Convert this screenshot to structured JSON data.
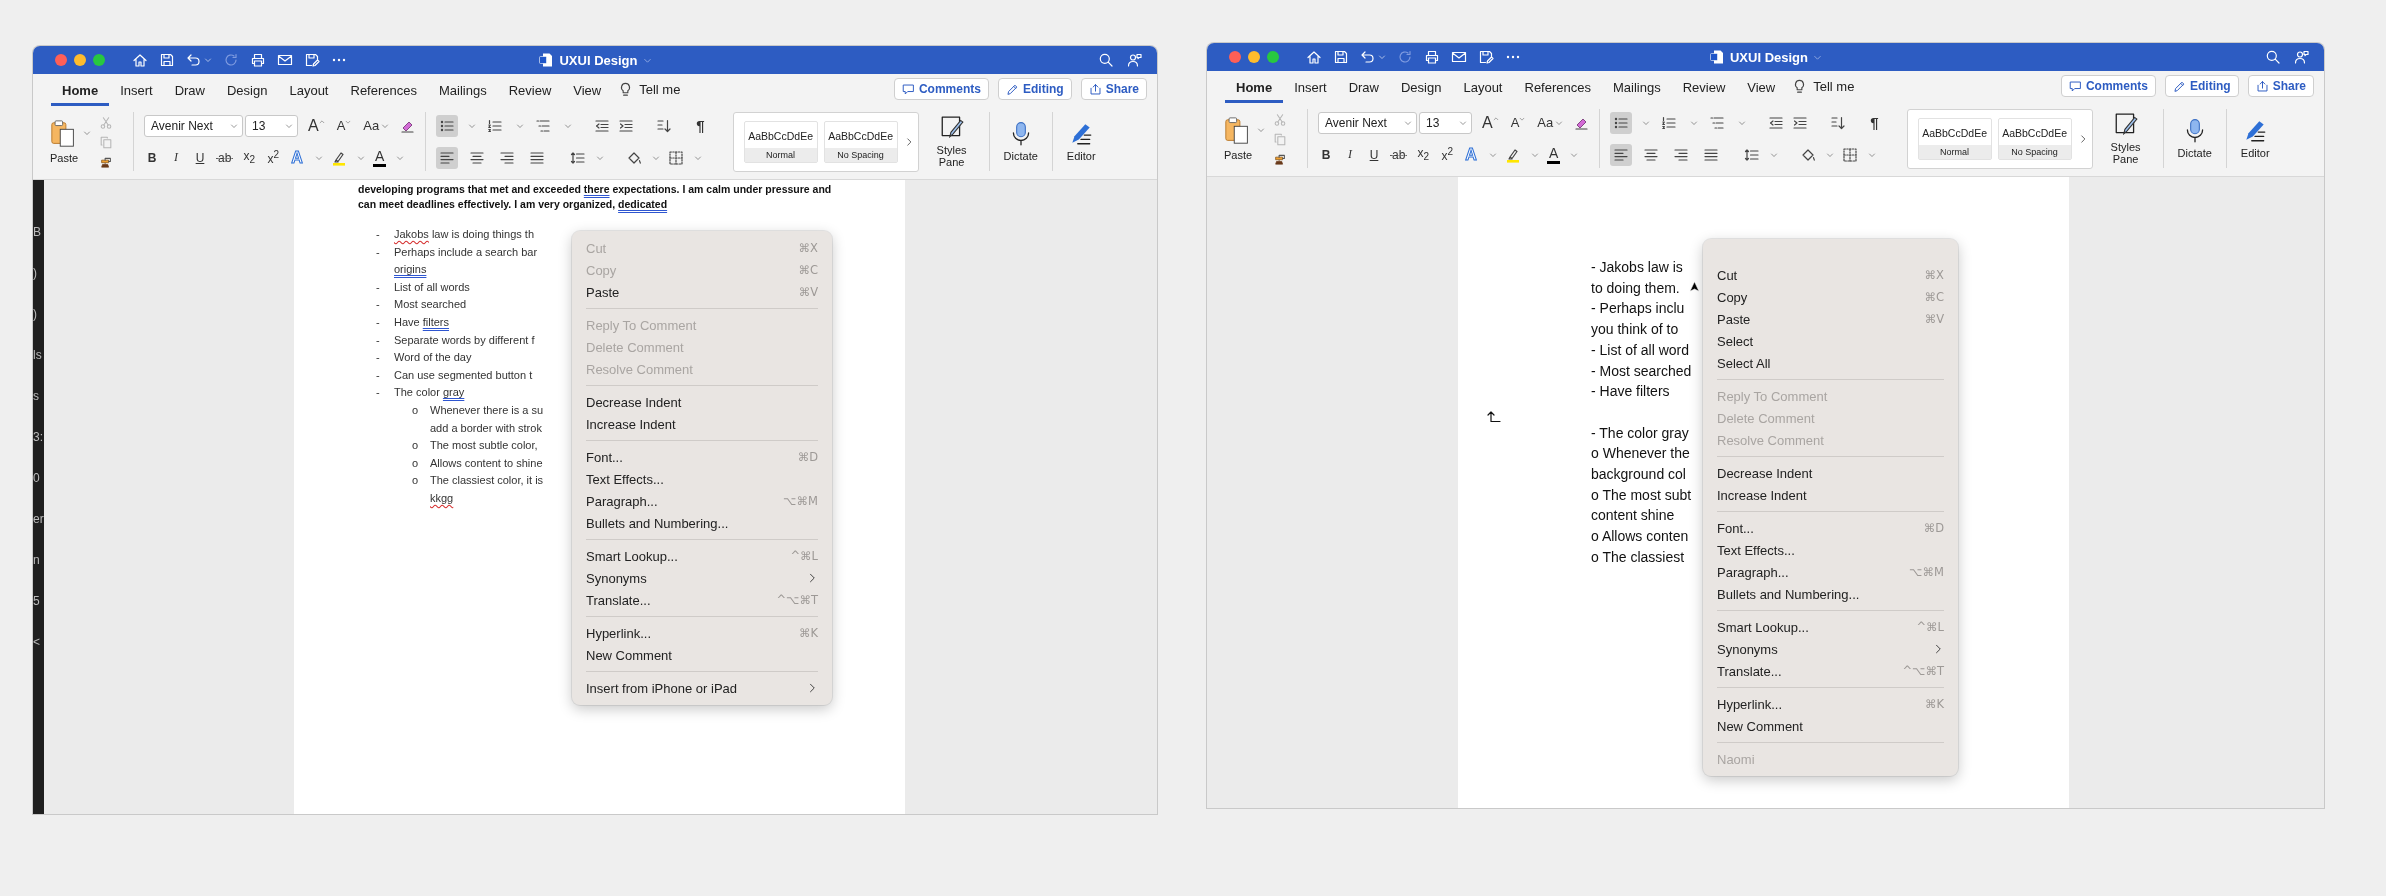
{
  "windows": [
    {
      "title": "UXUI Design",
      "quick_access": [
        {
          "kind": "home",
          "disabled": false
        },
        {
          "kind": "save",
          "disabled": false
        },
        {
          "kind": "undo",
          "disabled": false
        },
        {
          "kind": "redo",
          "disabled": true
        },
        {
          "kind": "print",
          "disabled": false
        },
        {
          "kind": "mail",
          "disabled": false
        },
        {
          "kind": "saveas",
          "disabled": false
        },
        {
          "kind": "more",
          "disabled": false
        }
      ],
      "tabs": [
        {
          "label": "Home",
          "selected": true
        },
        {
          "label": "Insert",
          "selected": false
        },
        {
          "label": "Draw",
          "selected": false
        },
        {
          "label": "Design",
          "selected": false
        },
        {
          "label": "Layout",
          "selected": false
        },
        {
          "label": "References",
          "selected": false
        },
        {
          "label": "Mailings",
          "selected": false
        },
        {
          "label": "Review",
          "selected": false
        },
        {
          "label": "View",
          "selected": false
        }
      ],
      "tell_me": "Tell me",
      "actions": [
        {
          "kind": "comments",
          "label": "Comments"
        },
        {
          "kind": "editing",
          "label": "Editing"
        },
        {
          "kind": "share",
          "label": "Share"
        }
      ],
      "ribbon": {
        "paste": "Paste",
        "clipboard_tools": [
          {
            "kind": "cut",
            "disabled": true
          },
          {
            "kind": "copy",
            "disabled": true
          },
          {
            "kind": "painter",
            "disabled": false
          }
        ],
        "font_name": "Avenir Next",
        "font_size": "13",
        "grow_font": "A",
        "shrink_font": "A",
        "change_case": "Aa",
        "format_buttons": [
          "B",
          "I",
          "U",
          "ab",
          "x$_{2}$",
          "x$^{2}$"
        ],
        "text_effects": "A",
        "font_color": "A",
        "list_buttons": [
          {
            "kind": "bullets",
            "selected": true
          },
          {
            "kind": "numbering",
            "selected": false
          },
          {
            "kind": "multilevel",
            "selected": false
          }
        ],
        "show_marks": "¶",
        "align_buttons": [
          {
            "kind": "left",
            "selected": true
          },
          {
            "kind": "center",
            "selected": false
          },
          {
            "kind": "right",
            "selected": false
          },
          {
            "kind": "justify",
            "selected": false
          }
        ],
        "styles": [
          {
            "sample": "AaBbCcDdEe",
            "name": "Normal"
          },
          {
            "sample": "AaBbCcDdEe",
            "name": "No Spacing"
          }
        ],
        "styles_pane": "Styles Pane",
        "dictate": "Dictate",
        "editor": "Editor"
      },
      "side_strip": {
        "fragments": [
          "B",
          ")",
          ")",
          "ls",
          "s",
          "3:",
          "0",
          "er",
          "n",
          "5",
          "<"
        ]
      },
      "document": {
        "kind": "outline",
        "intro": [
          [
            {
              "kind": "plain",
              "text": "developing programs that met and exceeded "
            },
            {
              "kind": "grammar",
              "text": "there"
            },
            {
              "kind": "plain",
              "text": " expectations. I am calm under pressure and"
            }
          ],
          [
            {
              "kind": "plain",
              "text": "can meet deadlines effectively. I am very organized, "
            },
            {
              "kind": "grammar",
              "text": "dedicated"
            }
          ]
        ],
        "items": [
          {
            "marker": "-",
            "lines": [
              [
                {
                  "kind": "spelling",
                  "text": "Jakobs"
                },
                {
                  "kind": "plain",
                  "text": " law is doing things th"
                }
              ]
            ]
          },
          {
            "marker": "-",
            "lines": [
              [
                {
                  "kind": "plain",
                  "text": "Perhaps include a search bar"
                }
              ],
              [
                {
                  "kind": "grammar",
                  "text": "origins"
                }
              ]
            ]
          },
          {
            "marker": "-",
            "lines": [
              [
                {
                  "kind": "plain",
                  "text": "List of all words"
                }
              ]
            ]
          },
          {
            "marker": "-",
            "lines": [
              [
                {
                  "kind": "plain",
                  "text": "Most searched"
                }
              ]
            ]
          },
          {
            "marker": "-",
            "lines": [
              [
                {
                  "kind": "plain",
                  "text": "Have "
                },
                {
                  "kind": "grammar",
                  "text": "filters"
                }
              ]
            ]
          },
          {
            "marker": "-",
            "lines": [
              [
                {
                  "kind": "plain",
                  "text": "Separate words by different f"
                }
              ]
            ]
          },
          {
            "marker": "-",
            "lines": [
              [
                {
                  "kind": "plain",
                  "text": "Word of the day"
                }
              ]
            ]
          },
          {
            "marker": "-",
            "lines": [
              [
                {
                  "kind": "plain",
                  "text": "Can use segmented button t"
                }
              ]
            ]
          },
          {
            "marker": "-",
            "lines": [
              [
                {
                  "kind": "plain",
                  "text": "The color "
                },
                {
                  "kind": "grammar",
                  "text": "gray"
                }
              ]
            ],
            "children": [
              {
                "marker": "o",
                "lines": [
                  [
                    {
                      "kind": "plain",
                      "text": "Whenever there is a su"
                    }
                  ],
                  [
                    {
                      "kind": "plain",
                      "text": "add a border with strok"
                    }
                  ]
                ]
              },
              {
                "marker": "o",
                "lines": [
                  [
                    {
                      "kind": "plain",
                      "text": "The most subtle color,"
                    }
                  ]
                ]
              },
              {
                "marker": "o",
                "lines": [
                  [
                    {
                      "kind": "plain",
                      "text": "Allows content to shine"
                    }
                  ]
                ]
              },
              {
                "marker": "o",
                "lines": [
                  [
                    {
                      "kind": "plain",
                      "text": "The classiest color, it is"
                    }
                  ],
                  [
                    {
                      "kind": "spelling",
                      "text": "kkgg"
                    }
                  ]
                ]
              }
            ]
          }
        ]
      },
      "context_menu": [
        {
          "kind": "item",
          "label": "Cut",
          "shortcut": "⌘X",
          "disabled": true,
          "submenu": false
        },
        {
          "kind": "item",
          "label": "Copy",
          "shortcut": "⌘C",
          "disabled": true,
          "submenu": false
        },
        {
          "kind": "item",
          "label": "Paste",
          "shortcut": "⌘V",
          "disabled": false,
          "submenu": false
        },
        {
          "kind": "separator"
        },
        {
          "kind": "item",
          "label": "Reply To Comment",
          "disabled": true,
          "submenu": false
        },
        {
          "kind": "item",
          "label": "Delete Comment",
          "disabled": true,
          "submenu": false
        },
        {
          "kind": "item",
          "label": "Resolve Comment",
          "disabled": true,
          "submenu": false
        },
        {
          "kind": "separator"
        },
        {
          "kind": "item",
          "label": "Decrease Indent",
          "disabled": false,
          "submenu": false
        },
        {
          "kind": "item",
          "label": "Increase Indent",
          "disabled": false,
          "submenu": false
        },
        {
          "kind": "separator"
        },
        {
          "kind": "item",
          "label": "Font...",
          "shortcut": "⌘D",
          "disabled": false,
          "submenu": false
        },
        {
          "kind": "item",
          "label": "Text Effects...",
          "disabled": false,
          "submenu": false
        },
        {
          "kind": "item",
          "label": "Paragraph...",
          "shortcut": "⌥⌘M",
          "disabled": false,
          "submenu": false
        },
        {
          "kind": "item",
          "label": "Bullets and Numbering...",
          "disabled": false,
          "submenu": false
        },
        {
          "kind": "separator"
        },
        {
          "kind": "item",
          "label": "Smart Lookup...",
          "shortcut": "^⌘L",
          "disabled": false,
          "submenu": false
        },
        {
          "kind": "item",
          "label": "Synonyms",
          "disabled": false,
          "submenu": true
        },
        {
          "kind": "item",
          "label": "Translate...",
          "shortcut": "^⌥⌘T",
          "disabled": false,
          "submenu": false
        },
        {
          "kind": "separator"
        },
        {
          "kind": "item",
          "label": "Hyperlink...",
          "shortcut": "⌘K",
          "disabled": false,
          "submenu": false
        },
        {
          "kind": "item",
          "label": "New Comment",
          "disabled": false,
          "submenu": false
        },
        {
          "kind": "separator"
        },
        {
          "kind": "item",
          "label": "Insert from iPhone or iPad",
          "disabled": false,
          "submenu": true
        }
      ]
    },
    {
      "title": "UXUI Design",
      "quick_access": [
        {
          "kind": "home",
          "disabled": false
        },
        {
          "kind": "save",
          "disabled": false
        },
        {
          "kind": "undo",
          "disabled": false
        },
        {
          "kind": "redo",
          "disabled": true
        },
        {
          "kind": "print",
          "disabled": false
        },
        {
          "kind": "mail",
          "disabled": false
        },
        {
          "kind": "saveas",
          "disabled": false
        },
        {
          "kind": "more",
          "disabled": false
        }
      ],
      "tabs": [
        {
          "label": "Home",
          "selected": true
        },
        {
          "label": "Insert",
          "selected": false
        },
        {
          "label": "Draw",
          "selected": false
        },
        {
          "label": "Design",
          "selected": false
        },
        {
          "label": "Layout",
          "selected": false
        },
        {
          "label": "References",
          "selected": false
        },
        {
          "label": "Mailings",
          "selected": false
        },
        {
          "label": "Review",
          "selected": false
        },
        {
          "label": "View",
          "selected": false
        }
      ],
      "tell_me": "Tell me",
      "actions": [
        {
          "kind": "comments",
          "label": "Comments"
        },
        {
          "kind": "editing",
          "label": "Editing"
        },
        {
          "kind": "share",
          "label": "Share"
        }
      ],
      "ribbon": {
        "paste": "Paste",
        "clipboard_tools": [
          {
            "kind": "cut",
            "disabled": true
          },
          {
            "kind": "copy",
            "disabled": true
          },
          {
            "kind": "painter",
            "disabled": false
          }
        ],
        "font_name": "Avenir Next",
        "font_size": "13",
        "grow_font": "A",
        "shrink_font": "A",
        "change_case": "Aa",
        "format_buttons": [
          "B",
          "I",
          "U",
          "ab",
          "x$_{2}$",
          "x$^{2}$"
        ],
        "text_effects": "A",
        "font_color": "A",
        "list_buttons": [
          {
            "kind": "bullets",
            "selected": true
          },
          {
            "kind": "numbering",
            "selected": false
          },
          {
            "kind": "multilevel",
            "selected": false
          }
        ],
        "show_marks": "¶",
        "align_buttons": [
          {
            "kind": "left",
            "selected": true
          },
          {
            "kind": "center",
            "selected": false
          },
          {
            "kind": "right",
            "selected": false
          },
          {
            "kind": "justify",
            "selected": false
          }
        ],
        "styles": [
          {
            "sample": "AaBbCcDdEe",
            "name": "Normal"
          },
          {
            "sample": "AaBbCcDdEe",
            "name": "No Spacing"
          }
        ],
        "styles_pane": "Styles Pane",
        "dictate": "Dictate",
        "editor": "Editor"
      },
      "document": {
        "kind": "plain",
        "lines": [
          {
            "kind": "line",
            "text": "- Jakobs law is"
          },
          {
            "kind": "line",
            "text": "to doing them."
          },
          {
            "kind": "line",
            "text": "- Perhaps inclu"
          },
          {
            "kind": "line",
            "text": "you think of to"
          },
          {
            "kind": "line",
            "text": "- List of all word"
          },
          {
            "kind": "line",
            "text": "- Most searched"
          },
          {
            "kind": "line",
            "text": "- Have filters"
          },
          {
            "kind": "blank"
          },
          {
            "kind": "line",
            "text": "- The color gray"
          },
          {
            "kind": "line",
            "text": "o Whenever the"
          },
          {
            "kind": "line",
            "text": "background col"
          },
          {
            "kind": "line",
            "text": "o The most subt"
          },
          {
            "kind": "line",
            "text": "content shine"
          },
          {
            "kind": "line",
            "text": "o Allows conten"
          },
          {
            "kind": "line",
            "text": "o The classiest"
          }
        ]
      },
      "context_menu": [
        {
          "kind": "item",
          "label": "Cut",
          "shortcut": "⌘X",
          "disabled": false,
          "submenu": false
        },
        {
          "kind": "item",
          "label": "Copy",
          "shortcut": "⌘C",
          "disabled": false,
          "submenu": false
        },
        {
          "kind": "item",
          "label": "Paste",
          "shortcut": "⌘V",
          "disabled": false,
          "submenu": false
        },
        {
          "kind": "item",
          "label": "Select",
          "disabled": false,
          "submenu": false
        },
        {
          "kind": "item",
          "label": "Select All",
          "disabled": false,
          "submenu": false
        },
        {
          "kind": "separator"
        },
        {
          "kind": "item",
          "label": "Reply To Comment",
          "disabled": true,
          "submenu": false
        },
        {
          "kind": "item",
          "label": "Delete Comment",
          "disabled": true,
          "submenu": false
        },
        {
          "kind": "item",
          "label": "Resolve Comment",
          "disabled": true,
          "submenu": false
        },
        {
          "kind": "separator"
        },
        {
          "kind": "item",
          "label": "Decrease Indent",
          "disabled": false,
          "submenu": false
        },
        {
          "kind": "item",
          "label": "Increase Indent",
          "disabled": false,
          "submenu": false
        },
        {
          "kind": "separator"
        },
        {
          "kind": "item",
          "label": "Font...",
          "shortcut": "⌘D",
          "disabled": false,
          "submenu": false
        },
        {
          "kind": "item",
          "label": "Text Effects...",
          "disabled": false,
          "submenu": false
        },
        {
          "kind": "item",
          "label": "Paragraph...",
          "shortcut": "⌥⌘M",
          "disabled": false,
          "submenu": false
        },
        {
          "kind": "item",
          "label": "Bullets and Numbering...",
          "disabled": false,
          "submenu": false
        },
        {
          "kind": "separator"
        },
        {
          "kind": "item",
          "label": "Smart Lookup...",
          "shortcut": "^⌘L",
          "disabled": false,
          "submenu": false
        },
        {
          "kind": "item",
          "label": "Synonyms",
          "disabled": false,
          "submenu": true
        },
        {
          "kind": "item",
          "label": "Translate...",
          "shortcut": "^⌥⌘T",
          "disabled": false,
          "submenu": false
        },
        {
          "kind": "separator"
        },
        {
          "kind": "item",
          "label": "Hyperlink...",
          "shortcut": "⌘K",
          "disabled": false,
          "submenu": false
        },
        {
          "kind": "item",
          "label": "New Comment",
          "disabled": false,
          "submenu": false
        },
        {
          "kind": "separator"
        },
        {
          "kind": "item",
          "label": "Naomi",
          "disabled": true,
          "submenu": false
        }
      ]
    }
  ]
}
